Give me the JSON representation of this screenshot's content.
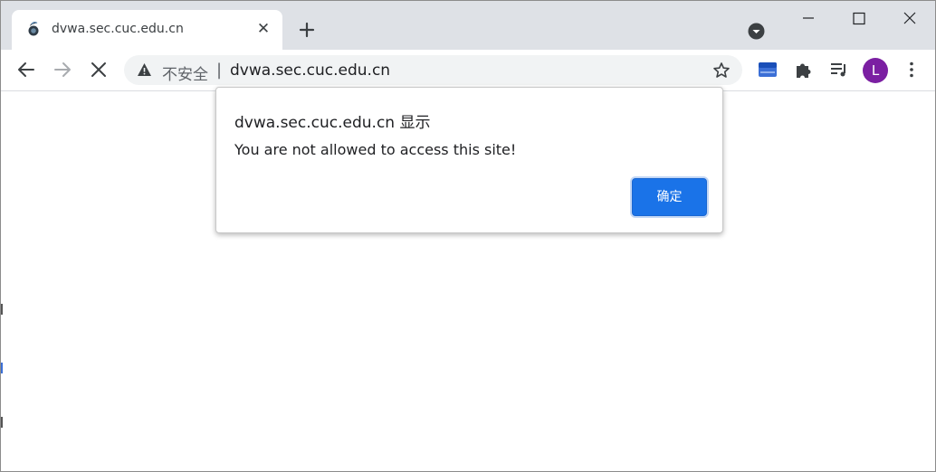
{
  "browser": {
    "tab": {
      "title": "dvwa.sec.cuc.edu.cn",
      "close_glyph": "✕",
      "favicon": "dvwa-favicon-icon"
    },
    "new_tab_icon": "plus-icon",
    "tab_search_icon": "chevron-down-circle-icon",
    "window_controls": [
      "minimize-icon",
      "maximize-icon",
      "close-icon"
    ]
  },
  "toolbar": {
    "back_icon": "arrow-left-icon",
    "forward_icon": "arrow-right-icon",
    "stop_icon": "stop-x-icon",
    "omnibox": {
      "security_icon": "warning-triangle-icon",
      "security_label": "不安全",
      "separator": "|",
      "url": "dvwa.sec.cuc.edu.cn",
      "bookmark_icon": "star-icon"
    },
    "extensions": [
      "blue-extension-icon",
      "puzzle-icon",
      "media-queue-icon"
    ],
    "profile_initial": "L",
    "menu_icon": "kebab-menu-icon"
  },
  "dialog": {
    "title": "dvwa.sec.cuc.edu.cn 显示",
    "message": "You are not allowed to access this site!",
    "ok_label": "确定"
  },
  "colors": {
    "tabstrip": "#dee1e6",
    "omnibox": "#f1f3f4",
    "accent": "#1a73e8",
    "avatar": "#7b1fa2"
  }
}
